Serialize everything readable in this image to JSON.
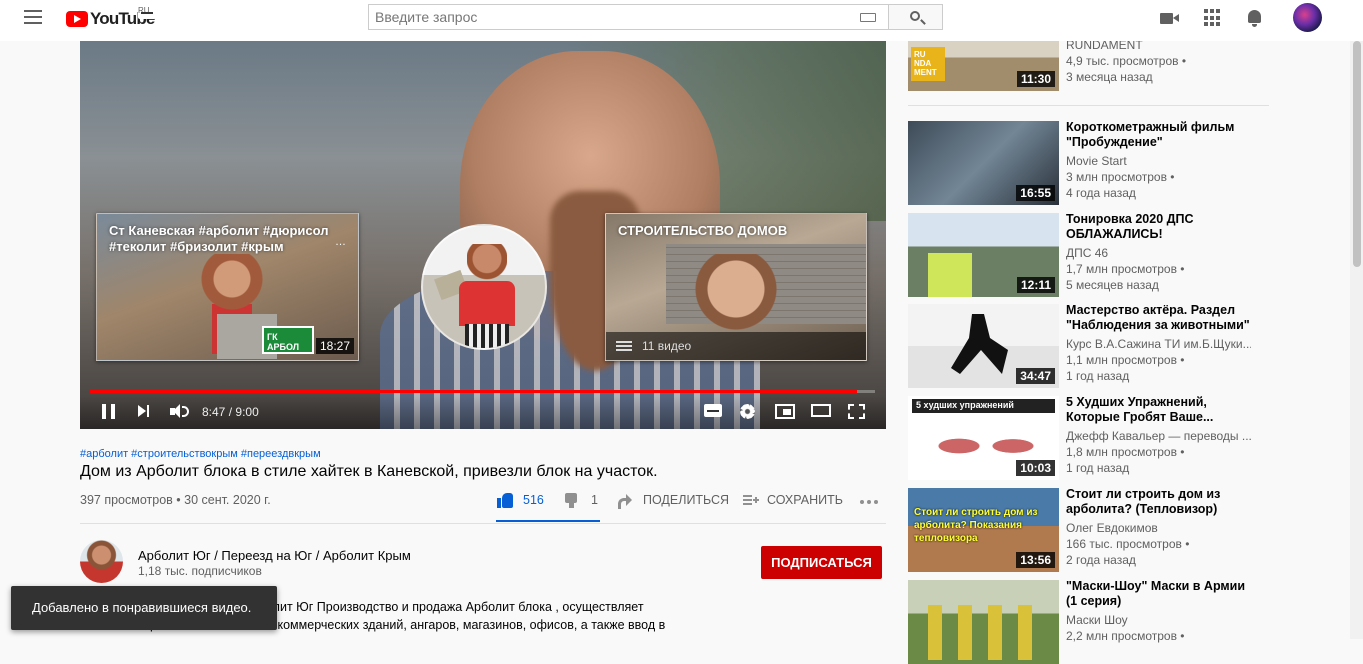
{
  "header": {
    "logo_text": "YouTube",
    "logo_region": "RU",
    "search_placeholder": "Введите запрос"
  },
  "player": {
    "progress_fraction": 0.977,
    "time_current": "8:47",
    "time_separator": "/",
    "time_total": "9:00",
    "end_cards": [
      {
        "title": "Ст Каневская #арболит #дюрисол #теколит #бризолит #крым",
        "duration": "18:27",
        "thumb_text": "ГК АРБОЛ"
      },
      {
        "title": "СТРОИТЕЛЬСТВО ДОМОВ",
        "playlist_count": "11 видео"
      }
    ]
  },
  "video": {
    "tags": "#арболит #строительствокрым #переездвкрым",
    "title": "Дом из Арболит блока в стиле хайтек в Каневской, привезли блок на участок.",
    "views_date": "397 просмотров • 30 сент. 2020 г.",
    "likes": "516",
    "dislikes": "1",
    "share_label": "ПОДЕЛИТЬСЯ",
    "save_label": "СОХРАНИТЬ"
  },
  "channel": {
    "name": "Арболит Юг / Переезд на Юг / Арболит Крым",
    "subscribers": "1,18 тыс. подписчиков",
    "subscribe_label": "ПОДПИСАТЬСЯ",
    "description_line1": "олит Юг Производство и продажа Арболит блока , осуществляет",
    "description_line2": "строительство жилых и коммерческих зданий, ангаров, магазинов, офисов, а также ввод в"
  },
  "toast": "Добавлено в понравившиеся видео.",
  "related": [
    {
      "title": "",
      "channel": "RUNDAMENT",
      "views": "4,9 тыс. просмотров •",
      "age": "3 месяца назад",
      "duration": "11:30",
      "thumb_text": "RU NDA MENT"
    },
    {
      "title": "Короткометражный фильм \"Пробуждение\"",
      "channel": "Movie Start",
      "views": "3 млн просмотров •",
      "age": "4 года назад",
      "duration": "16:55"
    },
    {
      "title": "Тонировка 2020 ДПС ОБЛАЖАЛИСЬ!",
      "channel": "ДПС 46",
      "views": "1,7 млн просмотров •",
      "age": "5 месяцев назад",
      "duration": "12:11"
    },
    {
      "title": "Мастерство актёра. Раздел \"Наблюдения за животными\"",
      "channel": "Курс В.А.Сажина ТИ им.Б.Щуки...",
      "views": "1,1 млн просмотров •",
      "age": "1 год назад",
      "duration": "34:47"
    },
    {
      "title": "5 Худших Упражнений, Которые Гробят Ваше...",
      "channel": "Джефф Кавальер — переводы ...",
      "views": "1,8 млн просмотров •",
      "age": "1 год назад",
      "duration": "10:03",
      "thumb_text": "5 худших упражнений"
    },
    {
      "title": "Стоит ли строить дом из арболита? (Тепловизор)",
      "channel": "Олег Евдокимов",
      "views": "166 тыс. просмотров •",
      "age": "2 года назад",
      "duration": "13:56",
      "thumb_text": "Стоит ли строить дом из арболита? Показания тепловизора"
    },
    {
      "title": "\"Маски-Шоу\" Маски в Армии (1 серия)",
      "channel": "Маски Шоу",
      "views": "2,2 млн просмотров •",
      "age": "",
      "duration": ""
    }
  ]
}
